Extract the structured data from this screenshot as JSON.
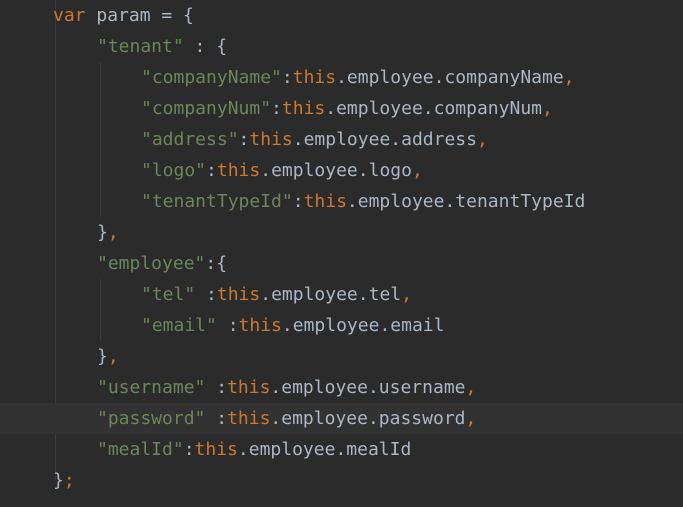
{
  "lines": [
    {
      "tokens": [
        {
          "t": "kw",
          "v": "var"
        },
        {
          "t": "txt",
          "v": " param = {"
        }
      ]
    },
    {
      "tokens": [
        {
          "t": "str",
          "v": "\"tenant\""
        },
        {
          "t": "txt",
          "v": " : {"
        }
      ]
    },
    {
      "tokens": [
        {
          "t": "str",
          "v": "\"companyName\""
        },
        {
          "t": "txt",
          "v": ":"
        },
        {
          "t": "kw",
          "v": "this"
        },
        {
          "t": "txt",
          "v": ".employee.companyName"
        },
        {
          "t": "kw",
          "v": ","
        }
      ]
    },
    {
      "tokens": [
        {
          "t": "str",
          "v": "\"companyNum\""
        },
        {
          "t": "txt",
          "v": ":"
        },
        {
          "t": "kw",
          "v": "this"
        },
        {
          "t": "txt",
          "v": ".employee.companyNum"
        },
        {
          "t": "kw",
          "v": ","
        }
      ]
    },
    {
      "tokens": [
        {
          "t": "str",
          "v": "\"address\""
        },
        {
          "t": "txt",
          "v": ":"
        },
        {
          "t": "kw",
          "v": "this"
        },
        {
          "t": "txt",
          "v": ".employee.address"
        },
        {
          "t": "kw",
          "v": ","
        }
      ]
    },
    {
      "tokens": [
        {
          "t": "str",
          "v": "\"logo\""
        },
        {
          "t": "txt",
          "v": ":"
        },
        {
          "t": "kw",
          "v": "this"
        },
        {
          "t": "txt",
          "v": ".employee.logo"
        },
        {
          "t": "kw",
          "v": ","
        }
      ]
    },
    {
      "tokens": [
        {
          "t": "str",
          "v": "\"tenantTypeId\""
        },
        {
          "t": "txt",
          "v": ":"
        },
        {
          "t": "kw",
          "v": "this"
        },
        {
          "t": "txt",
          "v": ".employee.tenantTypeId"
        }
      ]
    },
    {
      "tokens": [
        {
          "t": "txt",
          "v": "}"
        },
        {
          "t": "kw",
          "v": ","
        }
      ]
    },
    {
      "tokens": [
        {
          "t": "str",
          "v": "\"employee\""
        },
        {
          "t": "txt",
          "v": ":{"
        }
      ]
    },
    {
      "tokens": [
        {
          "t": "str",
          "v": "\"tel\""
        },
        {
          "t": "txt",
          "v": " :"
        },
        {
          "t": "kw",
          "v": "this"
        },
        {
          "t": "txt",
          "v": ".employee.tel"
        },
        {
          "t": "kw",
          "v": ","
        }
      ]
    },
    {
      "tokens": [
        {
          "t": "str",
          "v": "\"email\""
        },
        {
          "t": "txt",
          "v": " :"
        },
        {
          "t": "kw",
          "v": "this"
        },
        {
          "t": "txt",
          "v": ".employee.email"
        }
      ]
    },
    {
      "tokens": [
        {
          "t": "txt",
          "v": "}"
        },
        {
          "t": "kw",
          "v": ","
        }
      ]
    },
    {
      "tokens": [
        {
          "t": "str",
          "v": "\"username\""
        },
        {
          "t": "txt",
          "v": " :"
        },
        {
          "t": "kw",
          "v": "this"
        },
        {
          "t": "txt",
          "v": ".employee.username"
        },
        {
          "t": "kw",
          "v": ","
        }
      ]
    },
    {
      "tokens": [
        {
          "t": "str",
          "v": "\"password\""
        },
        {
          "t": "txt",
          "v": " :"
        },
        {
          "t": "kw",
          "v": "this"
        },
        {
          "t": "txt",
          "v": ".employee.password"
        },
        {
          "t": "kw",
          "v": ","
        }
      ]
    },
    {
      "tokens": [
        {
          "t": "str",
          "v": "\"mealId\""
        },
        {
          "t": "txt",
          "v": ":"
        },
        {
          "t": "kw",
          "v": "this"
        },
        {
          "t": "txt",
          "v": ".employee.mealId"
        }
      ]
    },
    {
      "tokens": [
        {
          "t": "txt",
          "v": "}"
        },
        {
          "t": "kw",
          "v": ";"
        }
      ]
    }
  ]
}
